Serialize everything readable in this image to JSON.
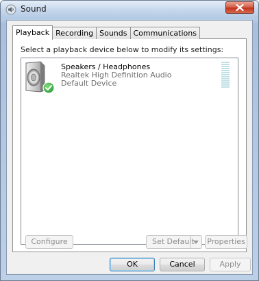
{
  "window": {
    "title": "Sound",
    "close_glyph": "x-icon"
  },
  "tabs": [
    {
      "label": "Playback",
      "active": true
    },
    {
      "label": "Recording",
      "active": false
    },
    {
      "label": "Sounds",
      "active": false
    },
    {
      "label": "Communications",
      "active": false
    }
  ],
  "playback": {
    "instruction": "Select a playback device below to modify its settings:",
    "devices": [
      {
        "name": "Speakers / Headphones",
        "driver": "Realtek High Definition Audio",
        "status": "Default Device",
        "icon": "speaker-icon",
        "badge": "default-checkmark-icon"
      }
    ]
  },
  "buttons": {
    "configure": "Configure",
    "set_default": "Set Default",
    "properties": "Properties",
    "ok": "OK",
    "cancel": "Cancel",
    "apply": "Apply"
  },
  "colors": {
    "accent_check": "#2e9e3b",
    "close_red": "#c1341c"
  }
}
